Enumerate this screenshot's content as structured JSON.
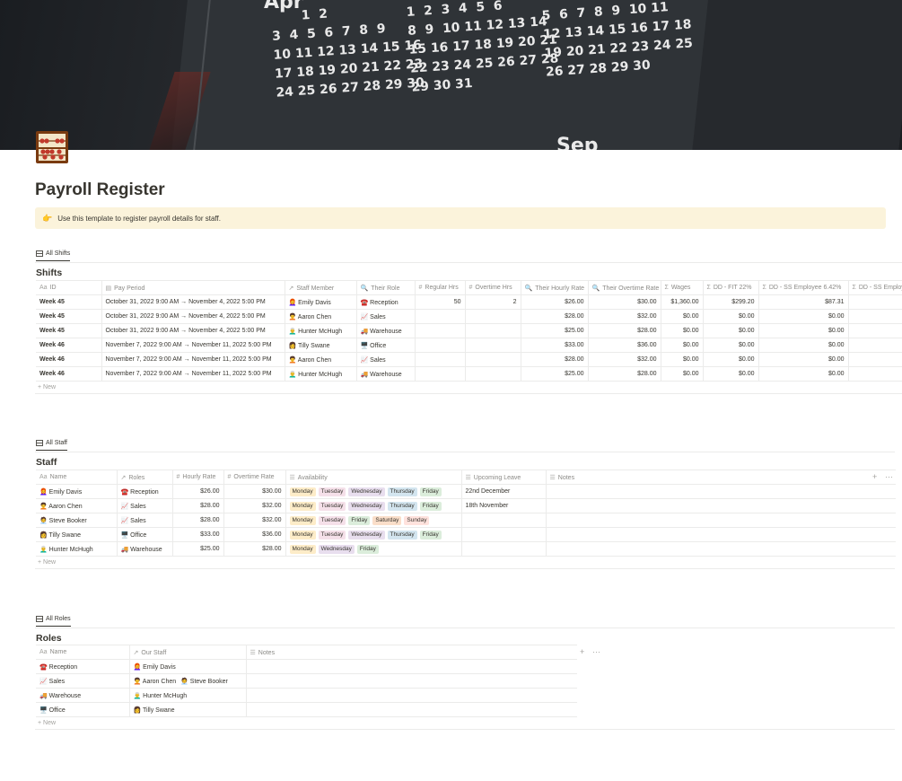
{
  "cover": {
    "month_a": "Apr",
    "month_b": "Sep",
    "cal_col1": "       1  2\n3  4  5  6  7  8  9\n10 11 12 13 14 15 16\n17 18 19 20 21 22 23\n24 25 26 27 28 29 30",
    "cal_col2": "1  2  3  4  5  6\n8  9  10 11 12 13 14\n15 16 17 18 19 20 21\n22 23 24 25 26 27 28\n29 30 31",
    "cal_col3": "5  6  7  8  9  10 11\n12 13 14 15 16 17 18\n19 20 21 22 23 24 25\n26 27 28 29 30"
  },
  "page": {
    "title": "Payroll Register",
    "callout_icon": "👉",
    "callout_text": "Use this template to register payroll details for staff."
  },
  "shifts": {
    "view_tab": "All Shifts",
    "title": "Shifts",
    "headers": [
      "ID",
      "Pay Period",
      "Staff Member",
      "Their Role",
      "Regular Hrs",
      "Overtime Hrs",
      "Their Hourly Rate",
      "Their Overtime Rate",
      "Wages",
      "DD - FIT 22%",
      "DD - SS Employee 6.42%",
      "DD - SS Employe"
    ],
    "header_icons": [
      "Aa",
      "▤",
      "↗",
      "🔍",
      "#",
      "#",
      "🔍",
      "🔍",
      "Σ",
      "Σ",
      "Σ",
      "Σ"
    ],
    "rows": [
      [
        "Week 45",
        "October 31, 2022 9:00 AM → November 4, 2022 5:00 PM",
        "👩‍🦰 Emily Davis",
        "☎️ Reception",
        "50",
        "2",
        "$26.00",
        "$30.00",
        "$1,360.00",
        "$299.20",
        "$87.31",
        ""
      ],
      [
        "Week 45",
        "October 31, 2022 9:00 AM → November 4, 2022 5:00 PM",
        "🧑‍🦱 Aaron Chen",
        "📈 Sales",
        "",
        "",
        "$28.00",
        "$32.00",
        "$0.00",
        "$0.00",
        "$0.00",
        ""
      ],
      [
        "Week 45",
        "October 31, 2022 9:00 AM → November 4, 2022 5:00 PM",
        "👨‍🦳 Hunter McHugh",
        "🚚 Warehouse",
        "",
        "",
        "$25.00",
        "$28.00",
        "$0.00",
        "$0.00",
        "$0.00",
        ""
      ],
      [
        "Week 46",
        "November 7, 2022 9:00 AM → November 11, 2022 5:00 PM",
        "👩 Tilly Swane",
        "🖥️ Office",
        "",
        "",
        "$33.00",
        "$36.00",
        "$0.00",
        "$0.00",
        "$0.00",
        ""
      ],
      [
        "Week 46",
        "November 7, 2022 9:00 AM → November 11, 2022 5:00 PM",
        "🧑‍🦱 Aaron Chen",
        "📈 Sales",
        "",
        "",
        "$28.00",
        "$32.00",
        "$0.00",
        "$0.00",
        "$0.00",
        ""
      ],
      [
        "Week 46",
        "November 7, 2022 9:00 AM → November 11, 2022 5:00 PM",
        "👨‍🦳 Hunter McHugh",
        "🚚 Warehouse",
        "",
        "",
        "$25.00",
        "$28.00",
        "$0.00",
        "$0.00",
        "$0.00",
        ""
      ]
    ],
    "new_label": "+ New"
  },
  "staff": {
    "view_tab": "All Staff",
    "title": "Staff",
    "headers": [
      "Name",
      "Roles",
      "Hourly Rate",
      "Overtime Rate",
      "Availability",
      "Upcoming Leave",
      "Notes"
    ],
    "header_icons": [
      "Aa",
      "↗",
      "#",
      "#",
      "☰",
      "☰",
      "☰"
    ],
    "rows": [
      {
        "name": "👩‍🦰 Emily Davis",
        "role": "☎️ Reception",
        "hourly": "$26.00",
        "overtime": "$30.00",
        "availability": [
          "Monday",
          "Tuesday",
          "Wednesday",
          "Thursday",
          "Friday"
        ],
        "leave": "22nd December",
        "notes": ""
      },
      {
        "name": "🧑‍🦱 Aaron Chen",
        "role": "📈 Sales",
        "hourly": "$28.00",
        "overtime": "$32.00",
        "availability": [
          "Monday",
          "Tuesday",
          "Wednesday",
          "Thursday",
          "Friday"
        ],
        "leave": "18th November",
        "notes": ""
      },
      {
        "name": "🧑‍💼 Steve Booker",
        "role": "📈 Sales",
        "hourly": "$28.00",
        "overtime": "$32.00",
        "availability": [
          "Monday",
          "Tuesday",
          "Friday",
          "Saturday",
          "Sunday"
        ],
        "leave": "",
        "notes": ""
      },
      {
        "name": "👩 Tilly Swane",
        "role": "🖥️ Office",
        "hourly": "$33.00",
        "overtime": "$36.00",
        "availability": [
          "Monday",
          "Tuesday",
          "Wednesday",
          "Thursday",
          "Friday"
        ],
        "leave": "",
        "notes": ""
      },
      {
        "name": "👨‍🦳 Hunter McHugh",
        "role": "🚚 Warehouse",
        "hourly": "$25.00",
        "overtime": "$28.00",
        "availability": [
          "Monday",
          "Wednesday",
          "Friday"
        ],
        "leave": "",
        "notes": ""
      }
    ],
    "new_label": "+ New",
    "add_col": "+",
    "more": "···"
  },
  "roles": {
    "view_tab": "All Roles",
    "title": "Roles",
    "headers": [
      "Name",
      "Our Staff",
      "Notes"
    ],
    "header_icons": [
      "Aa",
      "↗",
      "☰"
    ],
    "rows": [
      {
        "name": "☎️ Reception",
        "staff": [
          "👩‍🦰 Emily Davis"
        ],
        "notes": ""
      },
      {
        "name": "📈 Sales",
        "staff": [
          "🧑‍🦱 Aaron Chen",
          "🧑‍💼 Steve Booker"
        ],
        "notes": ""
      },
      {
        "name": "🚚 Warehouse",
        "staff": [
          "👨‍🦳 Hunter McHugh"
        ],
        "notes": ""
      },
      {
        "name": "🖥️ Office",
        "staff": [
          "👩 Tilly Swane"
        ],
        "notes": ""
      }
    ],
    "new_label": "+ New",
    "add_col": "+",
    "more": "···"
  },
  "colors": {
    "callout_bg": "#fbf3db",
    "monday": "#fdecc8",
    "tuesday": "#f5e0e9",
    "wednesday": "#e8deee",
    "thursday": "#d3e5ef",
    "friday": "#dbeddb",
    "saturday": "#fadec9",
    "sunday": "#ffe2dd"
  }
}
